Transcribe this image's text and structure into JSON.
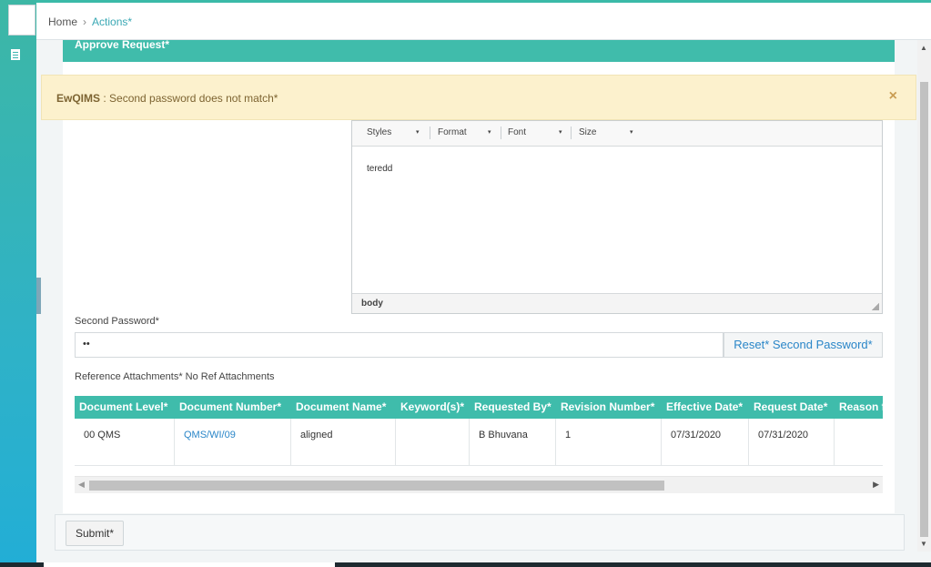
{
  "breadcrumb": {
    "home": "Home",
    "separator": "›",
    "current": "Actions*"
  },
  "panel": {
    "title": "Approve Request*"
  },
  "alert": {
    "app": "EwQIMS",
    "message": " : Second password does not match*",
    "close": "×"
  },
  "editor": {
    "toolbar": {
      "styles": "Styles",
      "format": "Format",
      "font": "Font",
      "size": "Size",
      "caret": "▾"
    },
    "content": "teredd",
    "status": "body"
  },
  "second_password": {
    "label": "Second Password*",
    "value": "••",
    "reset_label": "Reset* Second Password*"
  },
  "reference": {
    "label": "Reference Attachments* No Ref Attachments"
  },
  "table": {
    "headers": [
      "Document Level*",
      "Document Number*",
      "Document Name*",
      "Keyword(s)*",
      "Requested By*",
      "Revision Number*",
      "Effective Date*",
      "Request Date*",
      "Reason f"
    ],
    "rows": [
      [
        "00 QMS",
        "QMS/WI/09",
        "aligned",
        "",
        "B Bhuvana",
        "1",
        "07/31/2020",
        "07/31/2020",
        ""
      ]
    ]
  },
  "scroll": {
    "left": "◀",
    "right": "▶",
    "up": "▲",
    "down": "▼"
  },
  "footer": {
    "submit_label": "Submit*"
  },
  "colors": {
    "accent": "#40bcab",
    "link": "#2a86c8",
    "alert_bg": "#fcf1cd"
  }
}
